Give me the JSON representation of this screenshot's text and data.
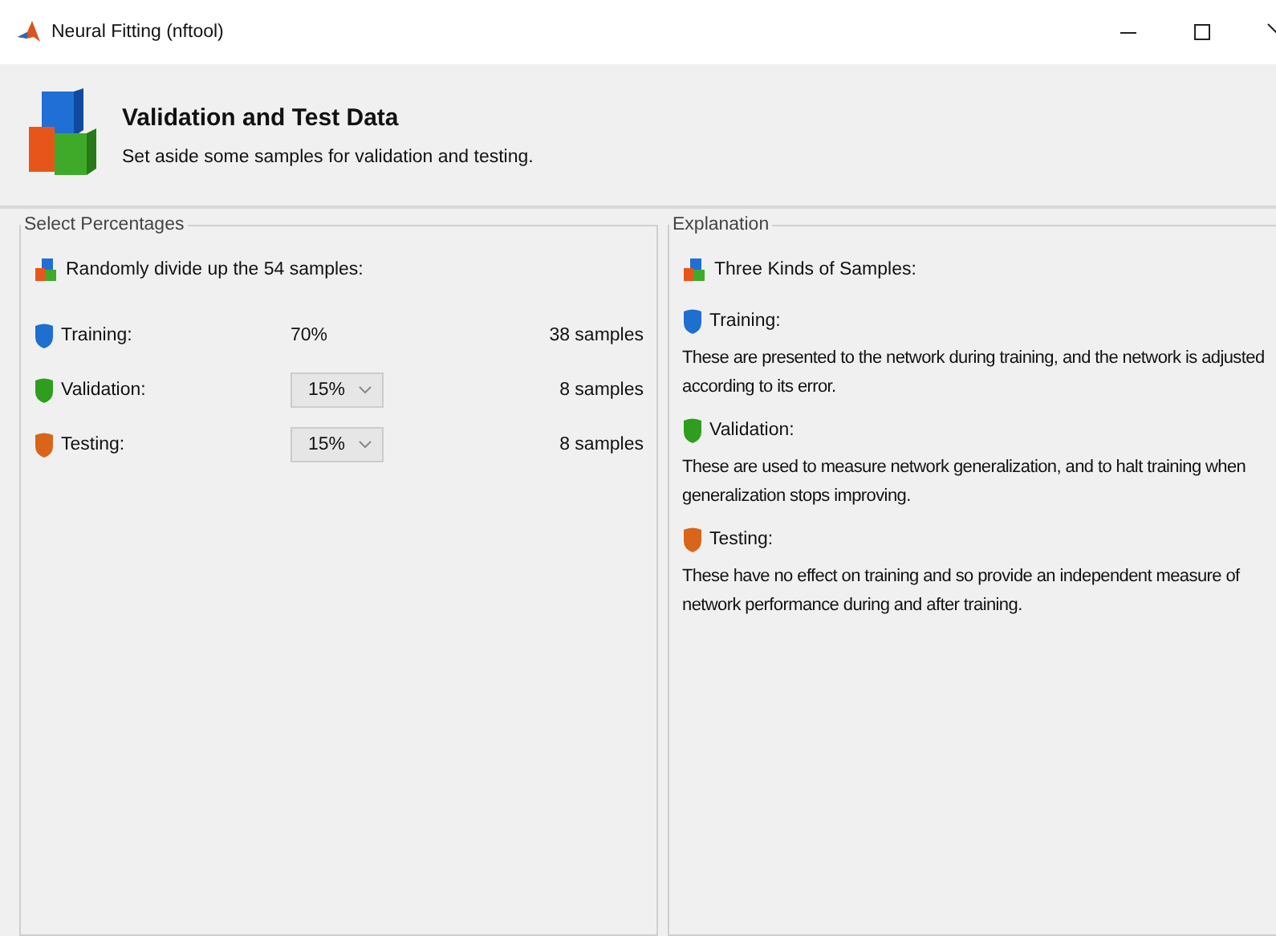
{
  "window": {
    "title": "Neural Fitting (nftool)"
  },
  "header": {
    "title": "Validation and Test Data",
    "subtitle": "Set aside some samples for validation and testing."
  },
  "select_panel": {
    "title": "Select Percentages",
    "intro": "Randomly divide up the 54 samples:",
    "rows": [
      {
        "label": "Training:",
        "kind": "fixed",
        "percent": "70%",
        "samples": "38 samples",
        "color": "#1e6fd0"
      },
      {
        "label": "Validation:",
        "kind": "dropdown",
        "percent": "15%",
        "samples": "8 samples",
        "color": "#2f9e1e"
      },
      {
        "label": "Testing:",
        "kind": "dropdown",
        "percent": "15%",
        "samples": "8 samples",
        "color": "#d9651a"
      }
    ]
  },
  "explanation_panel": {
    "title": "Explanation",
    "intro": "Three Kinds of Samples:",
    "sections": [
      {
        "heading": "Training:",
        "text": "These are presented to the network during training, and the network is adjusted according to its error.",
        "color": "#1e6fd0"
      },
      {
        "heading": "Validation:",
        "text": "These are used to measure network generalization, and to halt training when generalization stops improving.",
        "color": "#2f9e1e"
      },
      {
        "heading": "Testing:",
        "text": "These have no effect on training and so provide an independent measure of network performance during and after training.",
        "color": "#d9651a"
      }
    ]
  }
}
